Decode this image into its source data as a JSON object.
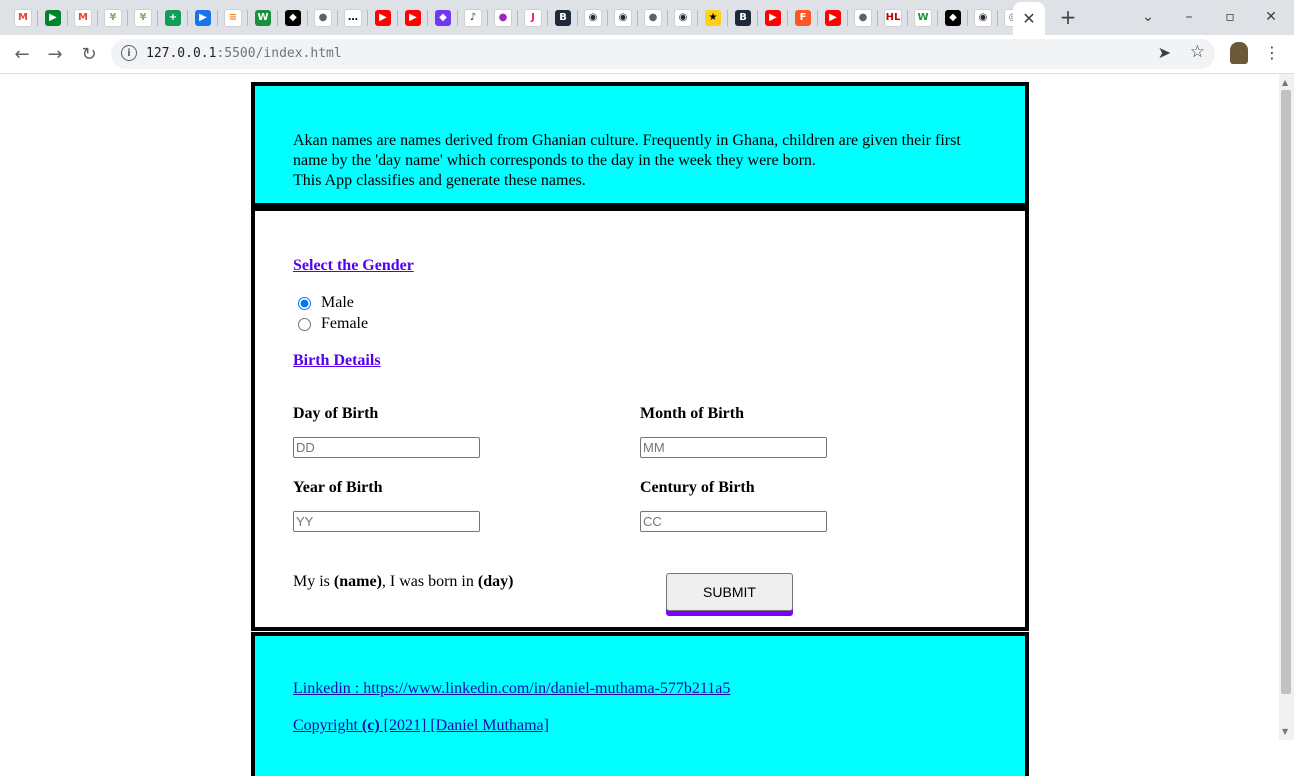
{
  "browser": {
    "active_tab_close": "✕",
    "new_tab": "+",
    "url_host": "127.0.0.1",
    "url_rest": ":5500/index.html",
    "window_controls": {
      "dropdown": "⌄",
      "minimize": "–",
      "maximize": "▫",
      "close": "✕"
    },
    "favicons": [
      {
        "name": "gmail-icon",
        "glyph": "M",
        "color": "#ea4335",
        "bg": "#ffffff"
      },
      {
        "name": "google-meet-icon",
        "glyph": "▶",
        "color": "#ffffff",
        "bg": "#00832d"
      },
      {
        "name": "gmail-icon",
        "glyph": "M",
        "color": "#ea4335",
        "bg": "#ffffff"
      },
      {
        "name": "palm-tree-icon",
        "glyph": "¥",
        "color": "#9aa36b",
        "bg": "#ffffff"
      },
      {
        "name": "palm-tree-icon",
        "glyph": "¥",
        "color": "#9aa36b",
        "bg": "#ffffff"
      },
      {
        "name": "google-sheets-plus-icon",
        "glyph": "+",
        "color": "#ffffff",
        "bg": "#0f9d58"
      },
      {
        "name": "video-play-icon",
        "glyph": "▶",
        "color": "#ffffff",
        "bg": "#1a73e8"
      },
      {
        "name": "stackoverflow-icon",
        "glyph": "≡",
        "color": "#f48024",
        "bg": "#ffffff"
      },
      {
        "name": "w-letter-icon",
        "glyph": "W",
        "color": "#ffffff",
        "bg": "#1c8f3c"
      },
      {
        "name": "black-shield-icon",
        "glyph": "◆",
        "color": "#ffffff",
        "bg": "#000000"
      },
      {
        "name": "globe-icon",
        "glyph": "●",
        "color": "#5f6368",
        "bg": "#ffffff"
      },
      {
        "name": "chat-bubble-icon",
        "glyph": "…",
        "color": "#000000",
        "bg": "#ffffff"
      },
      {
        "name": "youtube-icon",
        "glyph": "▶",
        "color": "#ffffff",
        "bg": "#ff0000"
      },
      {
        "name": "youtube-icon",
        "glyph": "▶",
        "color": "#ffffff",
        "bg": "#ff0000"
      },
      {
        "name": "purple-diamond-icon",
        "glyph": "◆",
        "color": "#ffffff",
        "bg": "#6d3af0"
      },
      {
        "name": "music-note-icon",
        "glyph": "♪",
        "color": "#333333",
        "bg": "#ffffff"
      },
      {
        "name": "location-pin-icon",
        "glyph": "●",
        "color": "#9c27b0",
        "bg": "#ffffff"
      },
      {
        "name": "j-letter-icon",
        "glyph": "J",
        "color": "#e91e63",
        "bg": "#ffffff"
      },
      {
        "name": "hexagon-b-icon",
        "glyph": "B",
        "color": "#ffffff",
        "bg": "#1e2a3a"
      },
      {
        "name": "github-icon",
        "glyph": "◉",
        "color": "#24292e",
        "bg": "#ffffff"
      },
      {
        "name": "github-icon",
        "glyph": "◉",
        "color": "#24292e",
        "bg": "#ffffff"
      },
      {
        "name": "globe-icon",
        "glyph": "●",
        "color": "#5f6368",
        "bg": "#ffffff"
      },
      {
        "name": "github-icon",
        "glyph": "◉",
        "color": "#24292e",
        "bg": "#ffffff"
      },
      {
        "name": "ghana-flag-icon",
        "glyph": "★",
        "color": "#000000",
        "bg": "#fcd116"
      },
      {
        "name": "hexagon-b-icon",
        "glyph": "B",
        "color": "#ffffff",
        "bg": "#1e2a3a"
      },
      {
        "name": "youtube-icon",
        "glyph": "▶",
        "color": "#ffffff",
        "bg": "#ff0000"
      },
      {
        "name": "f-letter-icon",
        "glyph": "F",
        "color": "#ffffff",
        "bg": "#ff5722"
      },
      {
        "name": "youtube-icon",
        "glyph": "▶",
        "color": "#ffffff",
        "bg": "#ff0000"
      },
      {
        "name": "globe-icon",
        "glyph": "●",
        "color": "#5f6368",
        "bg": "#ffffff"
      },
      {
        "name": "hl-letters-icon",
        "glyph": "HL",
        "color": "#c00000",
        "bg": "#ffffff"
      },
      {
        "name": "w-star-icon",
        "glyph": "W",
        "color": "#1c8f3c",
        "bg": "#ffffff"
      },
      {
        "name": "black-shield-icon",
        "glyph": "◆",
        "color": "#ffffff",
        "bg": "#000000"
      },
      {
        "name": "github-icon",
        "glyph": "◉",
        "color": "#24292e",
        "bg": "#ffffff"
      },
      {
        "name": "chrome-icon",
        "glyph": "◎",
        "color": "#5f6368",
        "bg": "#ffffff"
      }
    ]
  },
  "intro_text_line1": "Akan names are names derived from Ghanian culture. Frequently in Ghana, children are given their first",
  "intro_text_line2": "name by the 'day name' which corresponds to the day in the week they were born.",
  "intro_text_line3": "This App classifies and generate these names.",
  "form": {
    "gender_heading": "Select the Gender",
    "gender_options": [
      "Male",
      "Female"
    ],
    "gender_selected": "Male",
    "birth_heading": "Birth Details",
    "day_label": "Day of Birth",
    "day_placeholder": "DD",
    "month_label": "Month of Birth",
    "month_placeholder": "MM",
    "year_label": "Year of Birth",
    "year_placeholder": "YY",
    "century_label": "Century of Birth",
    "century_placeholder": "CC",
    "result_prefix": "My is ",
    "result_name": "(name)",
    "result_middle": ", I was born in ",
    "result_day": "(day)",
    "submit_label": "SUBMIT",
    "submit_shadow_color": "#7c00ff"
  },
  "footer": {
    "linkedin": "Linkedin : https://www.linkedin.com/in/daniel-muthama-577b211a5",
    "copyright_prefix": "Copyright ",
    "copyright_symbol": "(c)",
    "copyright_suffix": " [2021] [Daniel Muthama]"
  },
  "colors": {
    "panel_cyan": "#00ffff",
    "heading_link": "#5500ee",
    "link": "#1a0dab"
  }
}
